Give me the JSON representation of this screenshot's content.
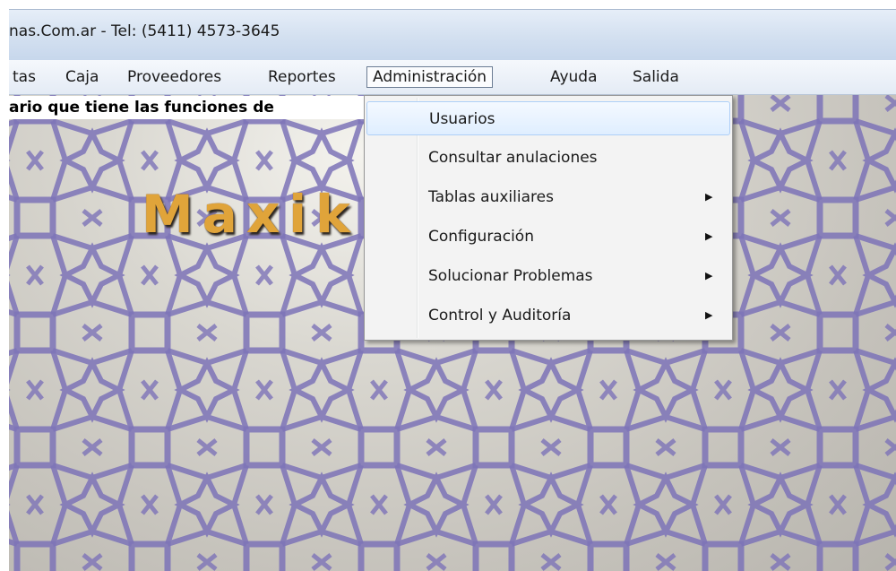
{
  "window": {
    "title": "nas.Com.ar - Tel: (5411) 4573-3645"
  },
  "menubar": {
    "items": [
      {
        "label": "tas",
        "name": "menu-ventas"
      },
      {
        "label": "Caja",
        "name": "menu-caja"
      },
      {
        "label": "Proveedores",
        "name": "menu-proveedores"
      },
      {
        "label": "Reportes",
        "name": "menu-reportes"
      },
      {
        "label": "Administración",
        "name": "menu-administracion",
        "active": true
      },
      {
        "label": "Ayuda",
        "name": "menu-ayuda"
      },
      {
        "label": "Salida",
        "name": "menu-salida"
      }
    ]
  },
  "info_bar": {
    "text": "ario que tiene las funciones de"
  },
  "brand": {
    "text": "Maxik"
  },
  "dropdown": {
    "items": [
      {
        "label": "Usuarios",
        "submenu": false,
        "highlighted": true
      },
      {
        "label": "Consultar anulaciones",
        "submenu": false
      },
      {
        "label": "Tablas auxiliares",
        "submenu": true
      },
      {
        "label": "Configuración",
        "submenu": true
      },
      {
        "label": "Solucionar Problemas",
        "submenu": true
      },
      {
        "label": "Control y Auditoría",
        "submenu": true
      }
    ],
    "submenu_icon": "triangle-right-icon"
  },
  "colors": {
    "title_bar": "#d3e0f0",
    "brand_text": "#e0a43a",
    "pattern_line": "#7d73b8",
    "highlight": "#dfeeff"
  }
}
